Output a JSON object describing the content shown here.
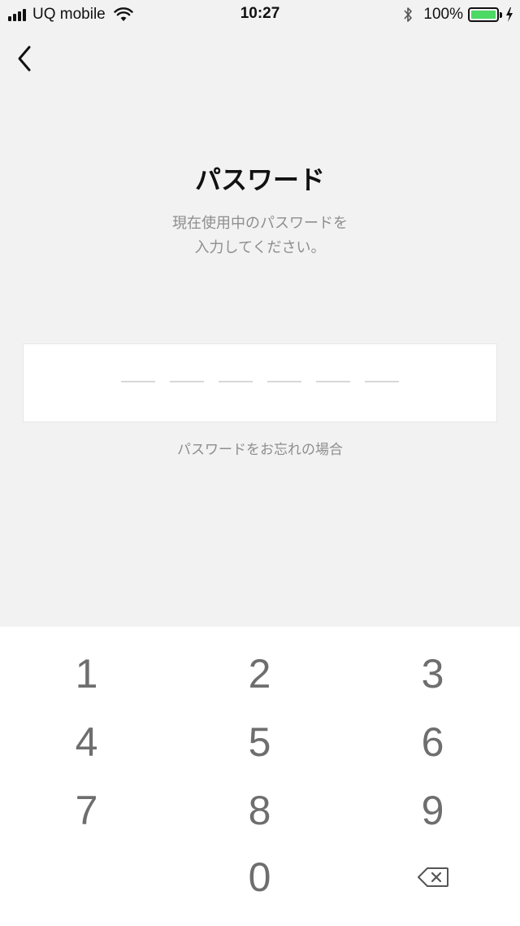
{
  "status_bar": {
    "carrier": "UQ mobile",
    "time": "10:27",
    "battery_percent": "100%",
    "battery_level": 1.0,
    "battery_color": "#4cd964",
    "icons": [
      "signal-icon",
      "wifi-icon",
      "bluetooth-icon",
      "battery-icon",
      "charging-bolt-icon"
    ]
  },
  "nav": {
    "back_icon": "chevron-left-icon"
  },
  "page": {
    "title": "パスワード",
    "description_line1": "現在使用中のパスワードを",
    "description_line2": "入力してください。",
    "forgot_link": "パスワードをお忘れの場合"
  },
  "password": {
    "length": 6,
    "entered": 0
  },
  "keypad": {
    "keys": [
      "1",
      "2",
      "3",
      "4",
      "5",
      "6",
      "7",
      "8",
      "9",
      "0"
    ],
    "delete_icon": "backspace-icon"
  },
  "colors": {
    "background": "#f2f2f2",
    "keypad_background": "#ffffff",
    "secondary_text": "#8e8e8e",
    "key_text": "#6e6e6e"
  }
}
